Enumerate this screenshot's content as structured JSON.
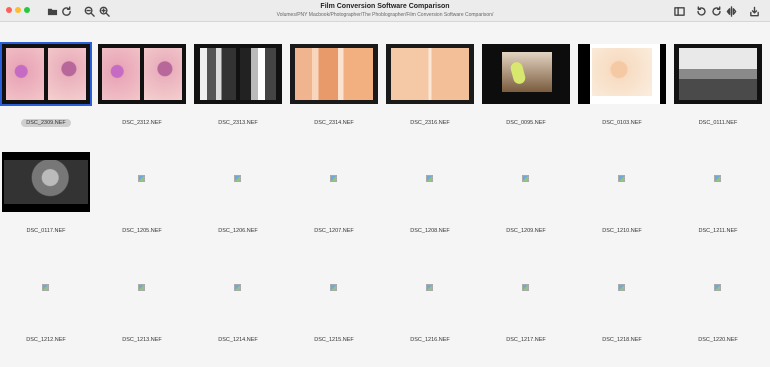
{
  "window": {
    "title": "Film Conversion Software Comparison",
    "path": "Volumes/PNY Macbook/Photographer/The Phoblographer/Film Conversion Software Comparison/"
  },
  "toolbar": {
    "icons": [
      "folder-icon",
      "refresh-icon",
      "zoom-out-icon",
      "zoom-in-icon",
      "split-view-icon",
      "rotate-left-icon",
      "rotate-right-icon",
      "flip-icon",
      "export-icon"
    ]
  },
  "thumbnails": [
    {
      "name": "DSC_2309.NEF",
      "selected": true,
      "preview": "pink-pair"
    },
    {
      "name": "DSC_2312.NEF",
      "preview": "pink-pair"
    },
    {
      "name": "DSC_2313.NEF",
      "preview": "bw-strip"
    },
    {
      "name": "DSC_2314.NEF",
      "preview": "orange-strip"
    },
    {
      "name": "DSC_2316.NEF",
      "preview": "orange-light"
    },
    {
      "name": "DSC_0095.NEF",
      "preview": "hand"
    },
    {
      "name": "DSC_0103.NEF",
      "preview": "portrait"
    },
    {
      "name": "DSC_0111.NEF",
      "preview": "bw-land"
    },
    {
      "name": "DSC_0117.NEF",
      "preview": "bw-tree"
    },
    {
      "name": "DSC_1205.NEF",
      "preview": "broken"
    },
    {
      "name": "DSC_1206.NEF",
      "preview": "broken"
    },
    {
      "name": "DSC_1207.NEF",
      "preview": "broken"
    },
    {
      "name": "DSC_1208.NEF",
      "preview": "broken"
    },
    {
      "name": "DSC_1209.NEF",
      "preview": "broken"
    },
    {
      "name": "DSC_1210.NEF",
      "preview": "broken"
    },
    {
      "name": "DSC_1211.NEF",
      "preview": "broken"
    },
    {
      "name": "DSC_1212.NEF",
      "preview": "broken"
    },
    {
      "name": "DSC_1213.NEF",
      "preview": "broken"
    },
    {
      "name": "DSC_1214.NEF",
      "preview": "broken"
    },
    {
      "name": "DSC_1215.NEF",
      "preview": "broken"
    },
    {
      "name": "DSC_1216.NEF",
      "preview": "broken"
    },
    {
      "name": "DSC_1217.NEF",
      "preview": "broken"
    },
    {
      "name": "DSC_1218.NEF",
      "preview": "broken"
    },
    {
      "name": "DSC_1220.NEF",
      "preview": "broken"
    }
  ]
}
